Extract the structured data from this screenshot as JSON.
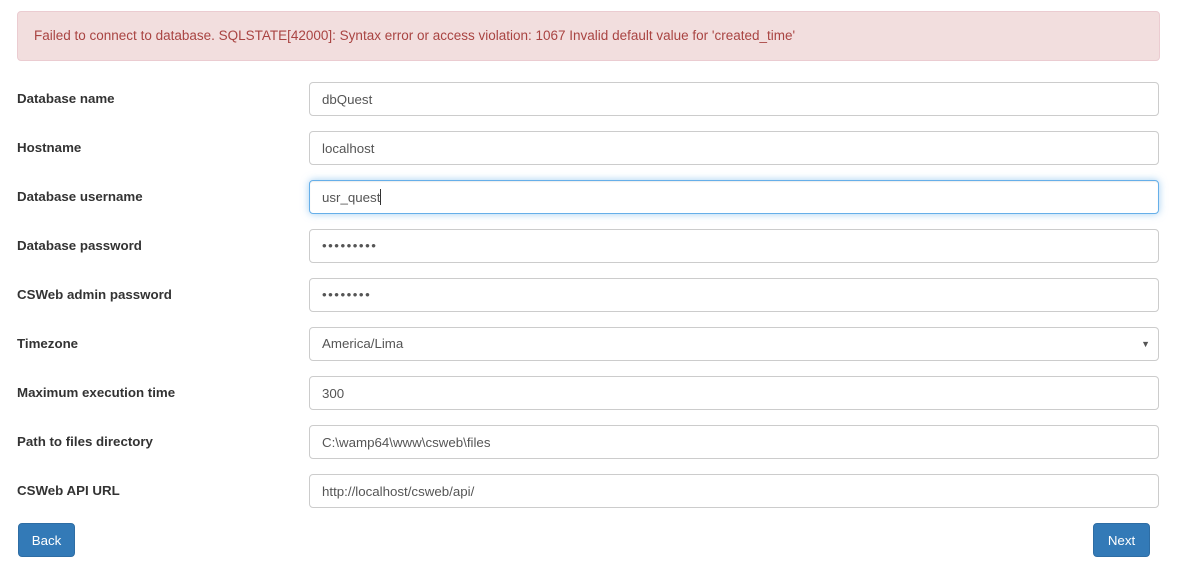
{
  "alert": {
    "type": "danger",
    "message": "Failed to connect to database. SQLSTATE[42000]: Syntax error or access violation: 1067 Invalid default value for 'created_time'",
    "background_color": "#f2dede",
    "border_color": "#ebccd1",
    "text_color": "#a94442"
  },
  "form": {
    "fields": [
      {
        "label": "Database name",
        "value": "dbQuest",
        "type": "text",
        "focused": false
      },
      {
        "label": "Hostname",
        "value": "localhost",
        "type": "text",
        "focused": false
      },
      {
        "label": "Database username",
        "value": "usr_quest",
        "type": "text",
        "focused": true
      },
      {
        "label": "Database password",
        "value": "•••••••••",
        "type": "password",
        "focused": false
      },
      {
        "label": "CSWeb admin password",
        "value": "••••••••",
        "type": "password",
        "focused": false
      },
      {
        "label": "Timezone",
        "value": "America/Lima",
        "type": "select",
        "focused": false,
        "arrow_icon": "chevron-down-icon",
        "arrow_glyph": "▼"
      },
      {
        "label": "Maximum execution time",
        "value": "300",
        "type": "text",
        "focused": false
      },
      {
        "label": "Path to files directory",
        "value": "C:\\wamp64\\www\\csweb\\files",
        "type": "text",
        "focused": false
      },
      {
        "label": "CSWeb API URL",
        "value": "http://localhost/csweb/api/",
        "type": "text",
        "focused": false
      }
    ]
  },
  "buttons": {
    "back_label": "Back",
    "next_label": "Next",
    "primary_color": "#337ab7",
    "primary_border_color": "#2e6da4"
  }
}
